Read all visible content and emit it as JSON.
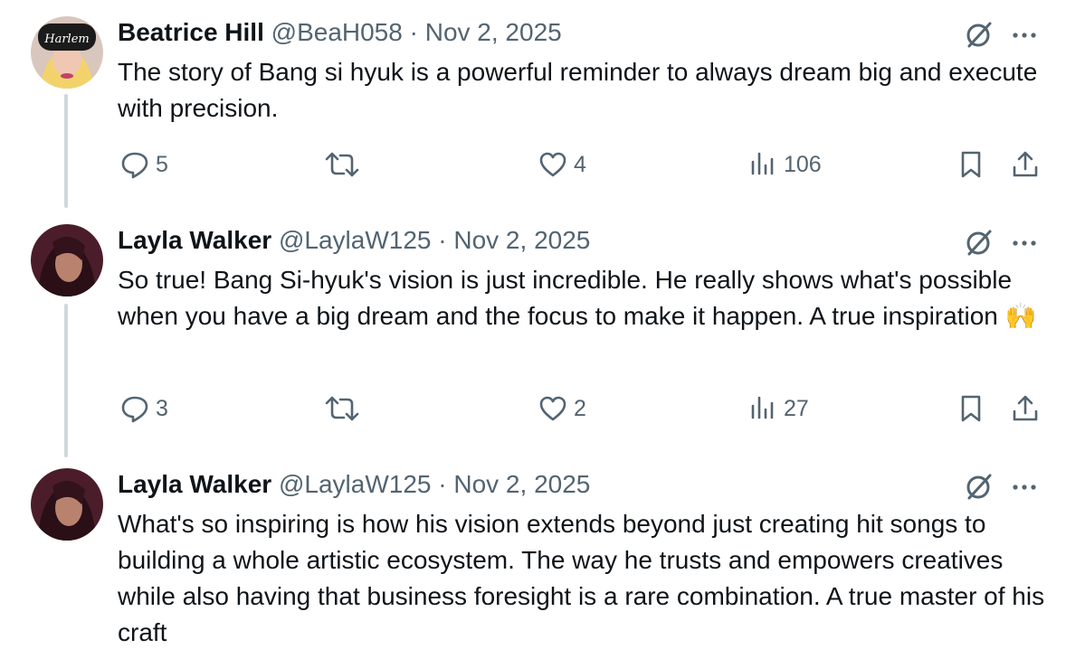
{
  "tweets": [
    {
      "name": "Beatrice Hill",
      "handle": "@BeaH058",
      "separator": "·",
      "date": "Nov 2, 2025",
      "text": "The story of Bang si hyuk is a powerful reminder to always dream big and execute with precision.",
      "replies": "5",
      "likes": "4",
      "views": "106",
      "avatar_badge": "Harlem"
    },
    {
      "name": "Layla Walker",
      "handle": "@LaylaW125",
      "separator": "·",
      "date": "Nov 2, 2025",
      "text": "So true! Bang Si-hyuk's vision is just incredible. He really shows what's possible when you have a big dream and the focus to make it happen. A true inspiration 🙌",
      "replies": "3",
      "likes": "2",
      "views": "27"
    },
    {
      "name": "Layla Walker",
      "handle": "@LaylaW125",
      "separator": "·",
      "date": "Nov 2, 2025",
      "text": "What's so inspiring is how his vision extends beyond just creating hit songs to building a whole artistic ecosystem. The way he trusts and empowers creatives while also having that business foresight is a rare combination. A true master of his craft"
    }
  ],
  "icons": [
    "reply-icon",
    "retweet-icon",
    "like-icon",
    "views-icon",
    "bookmark-icon",
    "share-icon",
    "grok-icon",
    "more-icon"
  ],
  "colors": {
    "text": "#0f1419",
    "secondary": "#536471",
    "thread_line": "#cfd9de"
  }
}
